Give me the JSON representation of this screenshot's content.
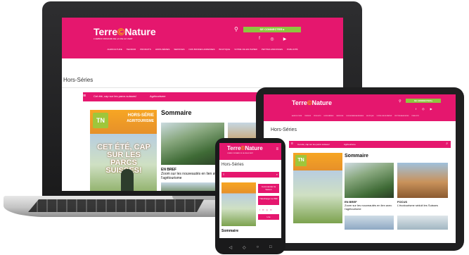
{
  "brand": {
    "name_pre": "Terre",
    "name_o": "©",
    "name_post": "Nature",
    "tagline": "L'HEBDO ROMAND DE LA VIE AU VERT"
  },
  "header": {
    "connect_label": "SE CONNECTER ▸",
    "search_icon": "search-icon",
    "social_icons": [
      "f",
      "◎",
      "▶"
    ],
    "nav": [
      "AGRICULTURE",
      "TERROIR",
      "PRODUITS",
      "HORS-SÉRIES",
      "SERVICES",
      "NOS BONNES ADRESSES",
      "BOUTIQUE",
      "VOTRE VIE EN PAPIER",
      "PETITES ANNONCES",
      "PUBLICITÉ"
    ]
  },
  "page": {
    "title": "Hors-Séries"
  },
  "filter": {
    "menu_icon": "≡",
    "item1": "Cet été, cap sur les parcs suisses!",
    "item2": "Agritourisme",
    "search_glyph": "⌕"
  },
  "cover": {
    "badge": "TN",
    "hs": "HORS-SÉRIE",
    "agri": "AGRITOURISME",
    "headline": "CET ÉTÉ, CAP SUR LES PARCS SUISSES!"
  },
  "sommaire": {
    "title": "Sommaire"
  },
  "articles": [
    {
      "kicker": "EN BREF",
      "desc": "Zoom sur les nouveautés en lien avec l'agritourisme"
    },
    {
      "kicker": "FOCUS",
      "desc": "L'écotourisme séduit les Suisses"
    }
  ],
  "phone": {
    "btn1": "Commandez la Saison",
    "btn2": "Télécharger le PDF",
    "btn3": "Lire",
    "socials": [
      "f",
      "✉",
      "◎",
      "✉"
    ],
    "menu_glyph": "≡",
    "softkeys": [
      "◁",
      "◇",
      "○",
      "□"
    ]
  },
  "colors": {
    "accent": "#e5176e",
    "green": "#8dc63f",
    "logo_o": "#f7c600"
  }
}
